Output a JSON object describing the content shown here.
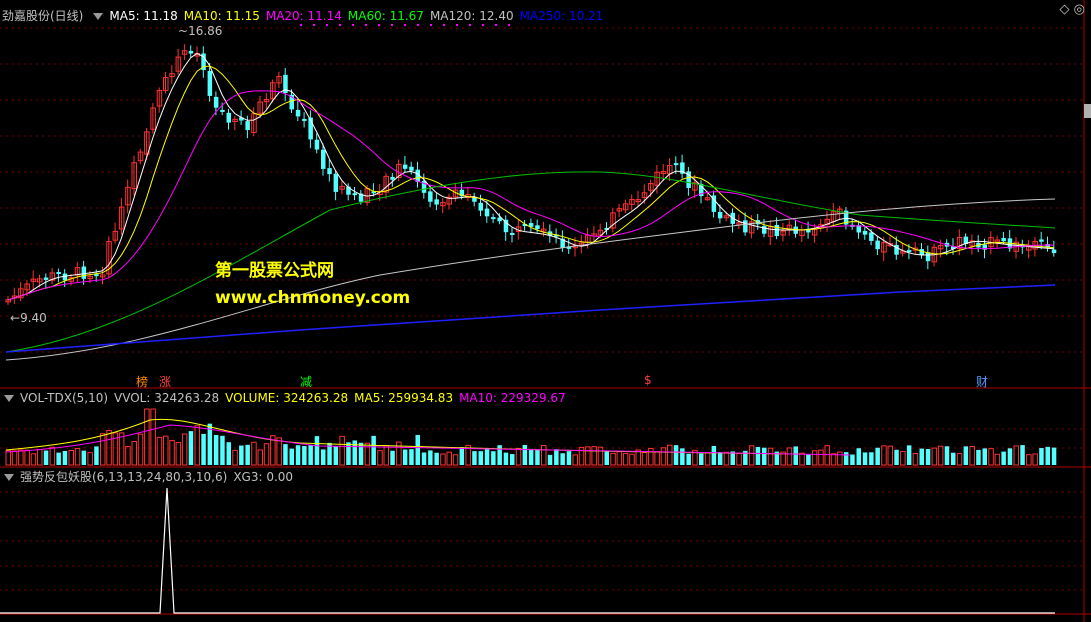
{
  "main_panel": {
    "stock_name": "劲嘉股份(日线)",
    "ma_items": [
      {
        "label": "MA5: 11.18",
        "color": "#ffffff"
      },
      {
        "label": "MA10: 11.15",
        "color": "#ffff00"
      },
      {
        "label": "MA20: 11.14",
        "color": "#ff00ff"
      },
      {
        "label": "MA60: 11.67",
        "color": "#00ff00"
      },
      {
        "label": "MA120: 12.40",
        "color": "#c0c0c0"
      },
      {
        "label": "MA250: 10.21",
        "color": "#0000ff"
      }
    ],
    "high_label": "16.86",
    "low_label": "9.40",
    "watermark_cn": "第一股票公式网",
    "watermark_url": "www.chnmoney.com",
    "event_markers": [
      {
        "text": "榜",
        "color": "#ff8800"
      },
      {
        "text": "涨",
        "color": "#ff4040"
      },
      {
        "text": "减",
        "color": "#00ff00"
      },
      {
        "text": "$",
        "color": "#ff4040"
      },
      {
        "text": "财",
        "color": "#4f9bff"
      }
    ],
    "up_color": "#ff3232",
    "down_color": "#54ffff"
  },
  "volume_panel": {
    "indicator": "VOL-TDX(5,10)",
    "items": [
      {
        "label": "VVOL: 324263.28",
        "color": "#c0c0c0"
      },
      {
        "label": "VOLUME: 324263.28",
        "color": "#ffff00"
      },
      {
        "label": "MA5: 259934.83",
        "color": "#ffff00"
      },
      {
        "label": "MA10: 229329.67",
        "color": "#ff00ff"
      }
    ]
  },
  "signal_panel": {
    "indicator": "强势反包妖股(6,13,13,24,80,3,10,6)",
    "value_label": "XG3: 0.00"
  },
  "right_control": "◇ ◎"
}
